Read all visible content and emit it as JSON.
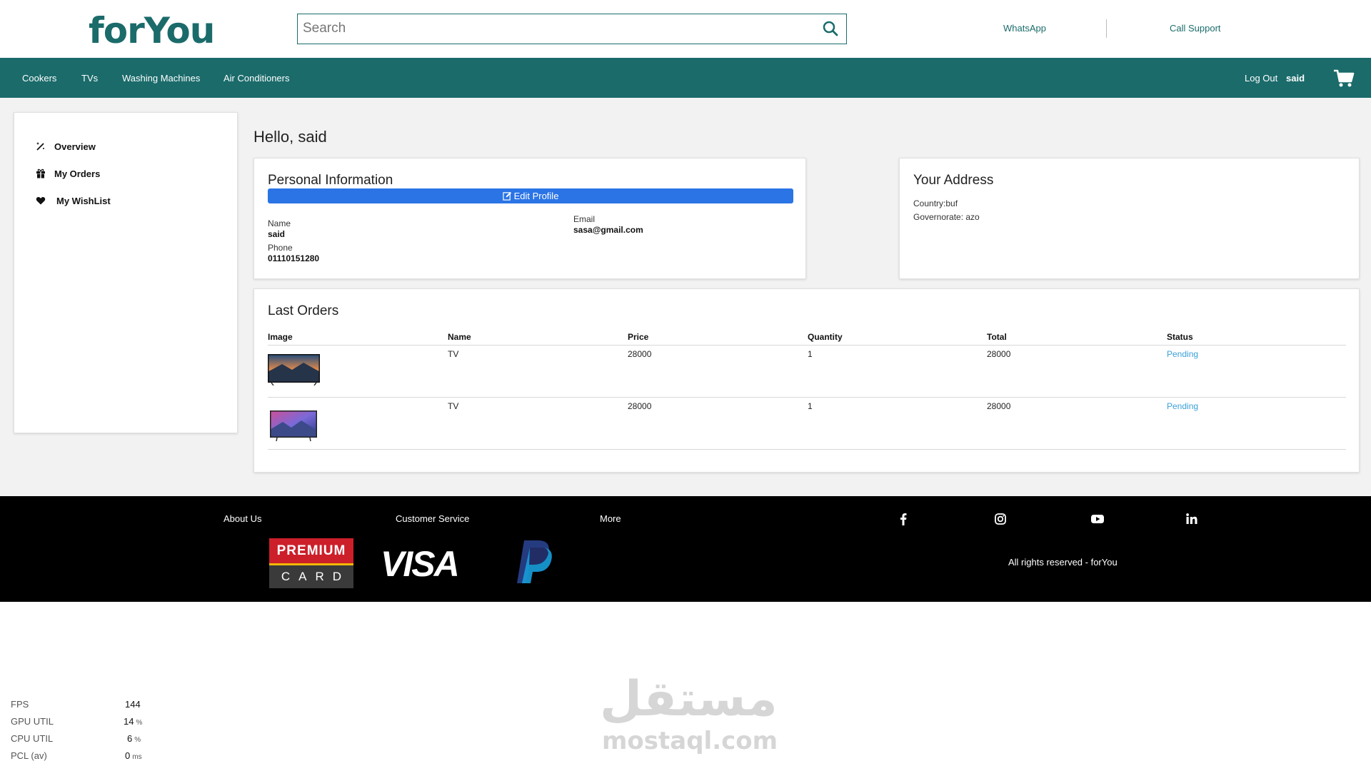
{
  "header": {
    "logo_text": "forYou",
    "search_placeholder": "Search",
    "links": {
      "whatsapp": "WhatsApp",
      "call_support": "Call Support"
    }
  },
  "nav": {
    "items": [
      "Cookers",
      "TVs",
      "Washing Machines",
      "Air Conditioners"
    ],
    "logout": "Log Out",
    "username": "said"
  },
  "sidebar": {
    "items": [
      {
        "label": "Overview",
        "icon": "magic-wand-icon"
      },
      {
        "label": "My Orders",
        "icon": "gift-icon"
      },
      {
        "label": "My WishList",
        "icon": "heart-icon"
      }
    ]
  },
  "greeting": "Hello, said",
  "personal_info": {
    "title": "Personal Information",
    "edit_label": "Edit Profile",
    "name_label": "Name",
    "name": "said",
    "phone_label": "Phone",
    "phone": "01110151280",
    "email_label": "Email",
    "email": "sasa@gmail.com"
  },
  "address": {
    "title": "Your Address",
    "country": "Country:buf",
    "governorate": "Governorate: azo"
  },
  "orders": {
    "title": "Last Orders",
    "columns": [
      "Image",
      "Name",
      "Price",
      "Quantity",
      "Total",
      "Status"
    ],
    "rows": [
      {
        "name": "TV",
        "price": "28000",
        "quantity": "1",
        "total": "28000",
        "status": "Pending"
      },
      {
        "name": "TV",
        "price": "28000",
        "quantity": "1",
        "total": "28000",
        "status": "Pending"
      }
    ]
  },
  "footer": {
    "links": [
      "About Us",
      "Customer Service",
      "More"
    ],
    "social_icons": [
      "facebook-icon",
      "instagram-icon",
      "youtube-icon",
      "linkedin-icon"
    ],
    "payment": {
      "premium_top": "PREMIUM",
      "premium_bottom": "CARD",
      "visa": "VISA"
    },
    "rights": "All rights reserved - forYou"
  },
  "perf": [
    {
      "label": "FPS",
      "value": "144",
      "unit": ""
    },
    {
      "label": "GPU UTIL",
      "value": "14",
      "unit": "%"
    },
    {
      "label": "CPU UTIL",
      "value": "6",
      "unit": "%"
    },
    {
      "label": "PCL (av)",
      "value": "0",
      "unit": "ms"
    }
  ],
  "watermark": {
    "arabic": "مستقل",
    "latin": "mostaql.com"
  },
  "colors": {
    "brand": "#1b6b6b",
    "button": "#2a74e6",
    "status": "#3aa0d8",
    "footer": "#000000"
  }
}
